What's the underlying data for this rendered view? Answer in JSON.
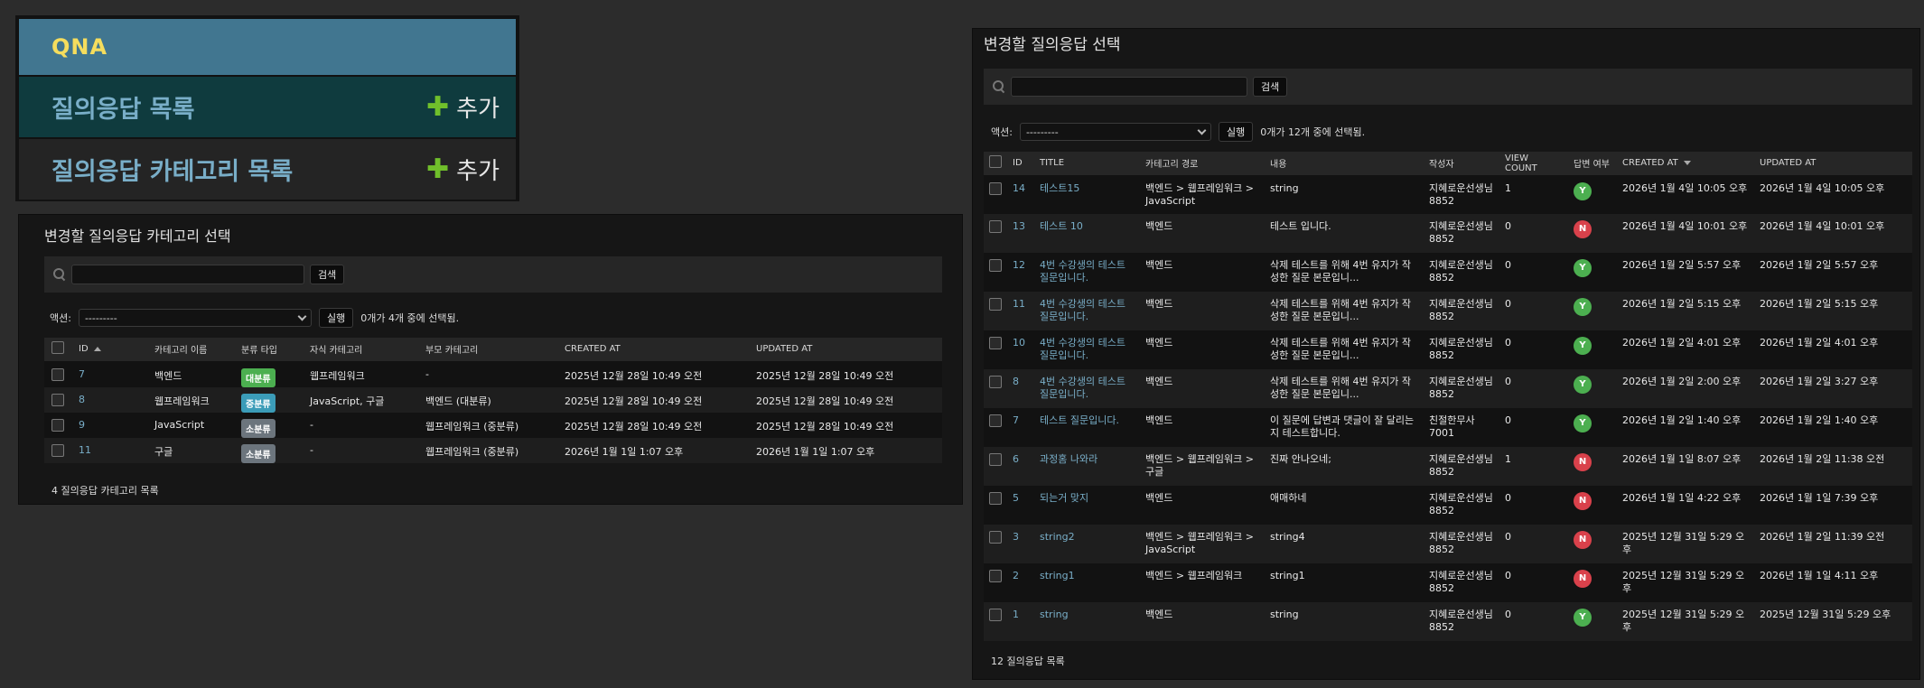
{
  "nav": {
    "app_title": "QNA",
    "items": [
      {
        "label": "질의응답 목록",
        "add_label": "추가"
      },
      {
        "label": "질의응답 카테고리 목록",
        "add_label": "추가"
      }
    ]
  },
  "category_list": {
    "title": "변경할 질의응답 카테고리 선택",
    "search_button": "검색",
    "search_value": "",
    "action_label": "액션:",
    "action_select": "---------",
    "run_button": "실행",
    "selection_text": "0개가 4개 중에 선택됨.",
    "columns": [
      "ID",
      "카테고리 이름",
      "분류 타입",
      "자식 카테고리",
      "부모 카테고리",
      "CREATED AT",
      "UPDATED AT"
    ],
    "rows": [
      {
        "id": "7",
        "name": "백엔드",
        "type": "대분류",
        "type_color": "#4caf50",
        "children": "웹프레임워크",
        "parent": "-",
        "created": "2025년 12월 28일 10:49 오전",
        "updated": "2025년 12월 28일 10:49 오전"
      },
      {
        "id": "8",
        "name": "웹프레임워크",
        "type": "중분류",
        "type_color": "#3b9cb8",
        "children": "JavaScript, 구글",
        "parent": "백엔드 (대분류)",
        "created": "2025년 12월 28일 10:49 오전",
        "updated": "2025년 12월 28일 10:49 오전"
      },
      {
        "id": "9",
        "name": "JavaScript",
        "type": "소분류",
        "type_color": "#6c757d",
        "children": "-",
        "parent": "웹프레임워크 (중분류)",
        "created": "2025년 12월 28일 10:49 오전",
        "updated": "2025년 12월 28일 10:49 오전"
      },
      {
        "id": "11",
        "name": "구글",
        "type": "소분류",
        "type_color": "#6c757d",
        "children": "-",
        "parent": "웹프레임워크 (중분류)",
        "created": "2026년 1월 1일 1:07 오후",
        "updated": "2026년 1월 1일 1:07 오후"
      }
    ],
    "footer": "4 질의응답 카테고리 목록"
  },
  "question_list": {
    "title": "변경할 질의응답 선택",
    "search_button": "검색",
    "search_value": "",
    "action_label": "액션:",
    "action_select": "---------",
    "run_button": "실행",
    "selection_text": "0개가 12개 중에 선택됨.",
    "columns": [
      "ID",
      "TITLE",
      "카테고리 경로",
      "내용",
      "작성자",
      "VIEW COUNT",
      "답변 여부",
      "CREATED AT",
      "UPDATED AT"
    ],
    "answer_colors": {
      "Y": "#4caf50",
      "N": "#d9414b"
    },
    "rows": [
      {
        "id": "14",
        "title": "테스트15",
        "path": "백엔드 > 웹프레임워크 > JavaScript",
        "content": "string",
        "author": "지혜로운선생님8852",
        "views": "1",
        "answered": "Y",
        "created": "2026년 1월 4일 10:05 오후",
        "updated": "2026년 1월 4일 10:05 오후"
      },
      {
        "id": "13",
        "title": "테스트 10",
        "path": "백엔드",
        "content": "테스트 입니다.",
        "author": "지혜로운선생님8852",
        "views": "0",
        "answered": "N",
        "created": "2026년 1월 4일 10:01 오후",
        "updated": "2026년 1월 4일 10:01 오후"
      },
      {
        "id": "12",
        "title": "4번 수강생의 테스트 질문입니다.",
        "path": "백엔드",
        "content": "삭제 테스트를 위해 4번 유지가 작성한 질문 본문입니...",
        "author": "지혜로운선생님8852",
        "views": "0",
        "answered": "Y",
        "created": "2026년 1월 2일 5:57 오후",
        "updated": "2026년 1월 2일 5:57 오후"
      },
      {
        "id": "11",
        "title": "4번 수강생의 테스트 질문입니다.",
        "path": "백엔드",
        "content": "삭제 테스트를 위해 4번 유지가 작성한 질문 본문입니...",
        "author": "지혜로운선생님8852",
        "views": "0",
        "answered": "Y",
        "created": "2026년 1월 2일 5:15 오후",
        "updated": "2026년 1월 2일 5:15 오후"
      },
      {
        "id": "10",
        "title": "4번 수강생의 테스트 질문입니다.",
        "path": "백엔드",
        "content": "삭제 테스트를 위해 4번 유지가 작성한 질문 본문입니...",
        "author": "지혜로운선생님8852",
        "views": "0",
        "answered": "Y",
        "created": "2026년 1월 2일 4:01 오후",
        "updated": "2026년 1월 2일 4:01 오후"
      },
      {
        "id": "8",
        "title": "4번 수강생의 테스트 질문입니다.",
        "path": "백엔드",
        "content": "삭제 테스트를 위해 4번 유지가 작성한 질문 본문입니...",
        "author": "지혜로운선생님8852",
        "views": "0",
        "answered": "Y",
        "created": "2026년 1월 2일 2:00 오후",
        "updated": "2026년 1월 2일 3:27 오후"
      },
      {
        "id": "7",
        "title": "테스트 질문입니다.",
        "path": "백엔드",
        "content": "이 질문에 답변과 댓글이 잘 달리는지 테스트합니다.",
        "author": "친절한무사7001",
        "views": "0",
        "answered": "Y",
        "created": "2026년 1월 2일 1:40 오후",
        "updated": "2026년 1월 2일 1:40 오후"
      },
      {
        "id": "6",
        "title": "과정홈 나와라",
        "path": "백엔드 > 웹프레임워크 > 구글",
        "content": "진짜 안나오네;",
        "author": "지혜로운선생님8852",
        "views": "1",
        "answered": "N",
        "created": "2026년 1월 1일 8:07 오후",
        "updated": "2026년 1월 2일 11:38 오전"
      },
      {
        "id": "5",
        "title": "되는거 맞지",
        "path": "백엔드",
        "content": "애매하네",
        "author": "지혜로운선생님8852",
        "views": "0",
        "answered": "N",
        "created": "2026년 1월 1일 4:22 오후",
        "updated": "2026년 1월 1일 7:39 오후"
      },
      {
        "id": "3",
        "title": "string2",
        "path": "백엔드 > 웹프레임워크 > JavaScript",
        "content": "string4",
        "author": "지혜로운선생님8852",
        "views": "0",
        "answered": "N",
        "created": "2025년 12월 31일 5:29 오후",
        "updated": "2026년 1월 2일 11:39 오전"
      },
      {
        "id": "2",
        "title": "string1",
        "path": "백엔드 > 웹프레임워크",
        "content": "string1",
        "author": "지혜로운선생님8852",
        "views": "0",
        "answered": "N",
        "created": "2025년 12월 31일 5:29 오후",
        "updated": "2026년 1월 1일 4:11 오후"
      },
      {
        "id": "1",
        "title": "string",
        "path": "백엔드",
        "content": "string",
        "author": "지혜로운선생님8852",
        "views": "0",
        "answered": "Y",
        "created": "2025년 12월 31일 5:29 오후",
        "updated": "2025년 12월 31일 5:29 오후"
      }
    ],
    "footer": "12 질의응답 목록"
  }
}
